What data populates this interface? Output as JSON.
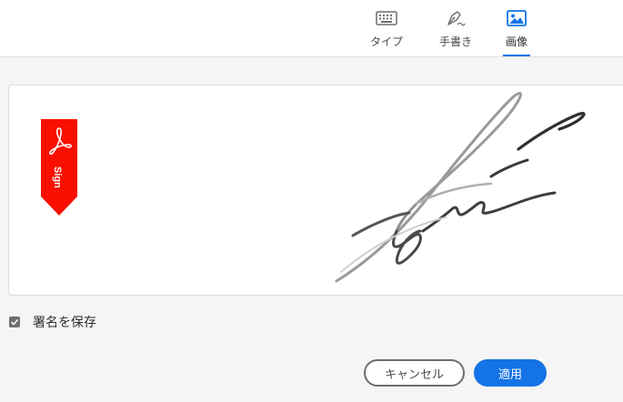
{
  "tabs": {
    "type_label": "タイプ",
    "draw_label": "手書き",
    "image_label": "画像"
  },
  "badge": {
    "text": "Sign"
  },
  "save": {
    "label": "署名を保存",
    "checked": true
  },
  "buttons": {
    "cancel_label": "キャンセル",
    "apply_label": "適用"
  },
  "colors": {
    "accent": "#1473e6",
    "badge_red": "#fa0f00"
  },
  "icons": {
    "type": "keyboard-icon",
    "draw": "pen-nib-icon",
    "image": "image-icon",
    "badge": "acrobat-logo-icon"
  }
}
